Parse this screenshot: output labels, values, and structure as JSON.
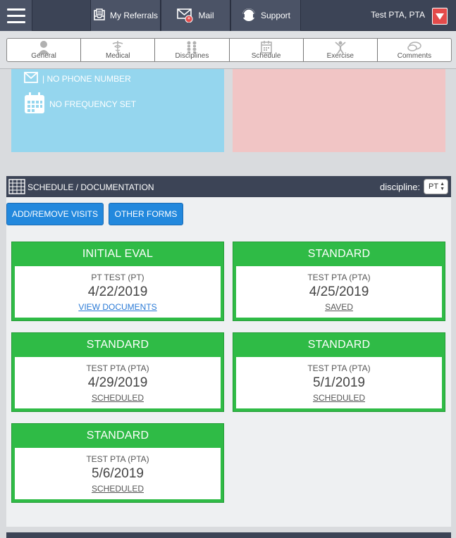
{
  "topbar": {
    "referrals_label": "My Referrals",
    "mail_label": "Mail",
    "support_label": "Support",
    "user_name": "Test PTA, PTA"
  },
  "tabs": [
    {
      "label": "General",
      "icon": "person-icon"
    },
    {
      "label": "Medical",
      "icon": "caduceus-icon"
    },
    {
      "label": "Disciplines",
      "icon": "people-icon"
    },
    {
      "label": "Schedule",
      "icon": "calendar-icon"
    },
    {
      "label": "Exercise",
      "icon": "exercise-icon"
    },
    {
      "label": "Comments",
      "icon": "chat-icon"
    }
  ],
  "patient_info": {
    "phone": "| NO PHONE NUMBER",
    "frequency": "NO FREQUENCY SET"
  },
  "schedule": {
    "title": "SCHEDULE / DOCUMENTATION",
    "discipline_label": "discipline:",
    "discipline_value": "PT",
    "add_remove_label": "ADD/REMOVE VISITS",
    "other_forms_label": "OTHER FORMS",
    "visits": [
      {
        "type": "INITIAL EVAL",
        "who": "PT TEST (PT)",
        "date": "4/22/2019",
        "status": "VIEW DOCUMENTS"
      },
      {
        "type": "STANDARD",
        "who": "TEST PTA (PTA)",
        "date": "4/25/2019",
        "status": "SAVED"
      },
      {
        "type": "STANDARD",
        "who": "TEST PTA (PTA)",
        "date": "4/29/2019",
        "status": "SCHEDULED"
      },
      {
        "type": "STANDARD",
        "who": "TEST PTA (PTA)",
        "date": "5/1/2019",
        "status": "SCHEDULED"
      },
      {
        "type": "STANDARD",
        "who": "TEST PTA (PTA)",
        "date": "5/6/2019",
        "status": "SCHEDULED"
      }
    ]
  },
  "colors": {
    "navbar": "#3c4456",
    "card_green": "#2fbb46",
    "button_blue": "#2288dd",
    "panel_blue": "#95d6ee",
    "panel_pink": "#f1c5c5",
    "alert_red": "#e34b4b"
  }
}
